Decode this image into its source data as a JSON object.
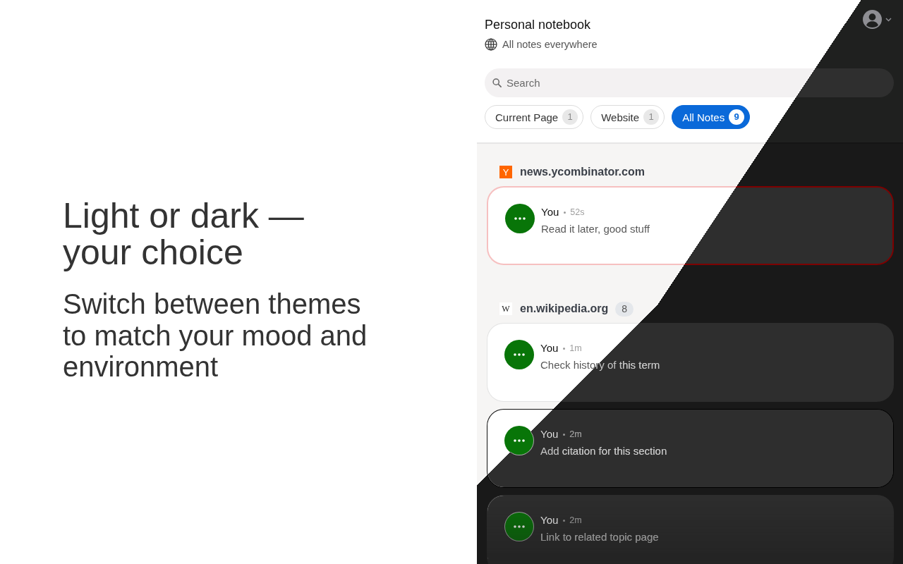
{
  "promo": {
    "headline": "Light or dark — your choice",
    "subtitle": "Switch between themes to match your mood and environment"
  },
  "panel": {
    "title": "Personal notebook",
    "scope": "All notes everywhere",
    "search": {
      "placeholder": "Search"
    },
    "filters": [
      {
        "label": "Current Page",
        "count": "1",
        "selected": false
      },
      {
        "label": "Website",
        "count": "1",
        "selected": false
      },
      {
        "label": "All Notes",
        "count": "9",
        "selected": true
      }
    ],
    "groups": [
      {
        "site": "news.ycombinator.com",
        "favicon": {
          "letter": "Y",
          "kind": "tile"
        },
        "notes": [
          {
            "author": "You",
            "time": "52s",
            "text": "Read it later, good stuff",
            "highlighted": true,
            "selected": false
          }
        ]
      },
      {
        "site": "en.wikipedia.org",
        "favicon": {
          "letter": "W",
          "kind": "serif"
        },
        "count": "8",
        "notes": [
          {
            "author": "You",
            "time": "1m",
            "text": "Check history of this term",
            "highlighted": false,
            "selected": false
          },
          {
            "author": "You",
            "time": "2m",
            "text": "Add citation for this section",
            "highlighted": false,
            "selected": true
          },
          {
            "author": "You",
            "time": "2m",
            "text": "Link to related topic page",
            "highlighted": false,
            "selected": false
          }
        ]
      }
    ]
  }
}
